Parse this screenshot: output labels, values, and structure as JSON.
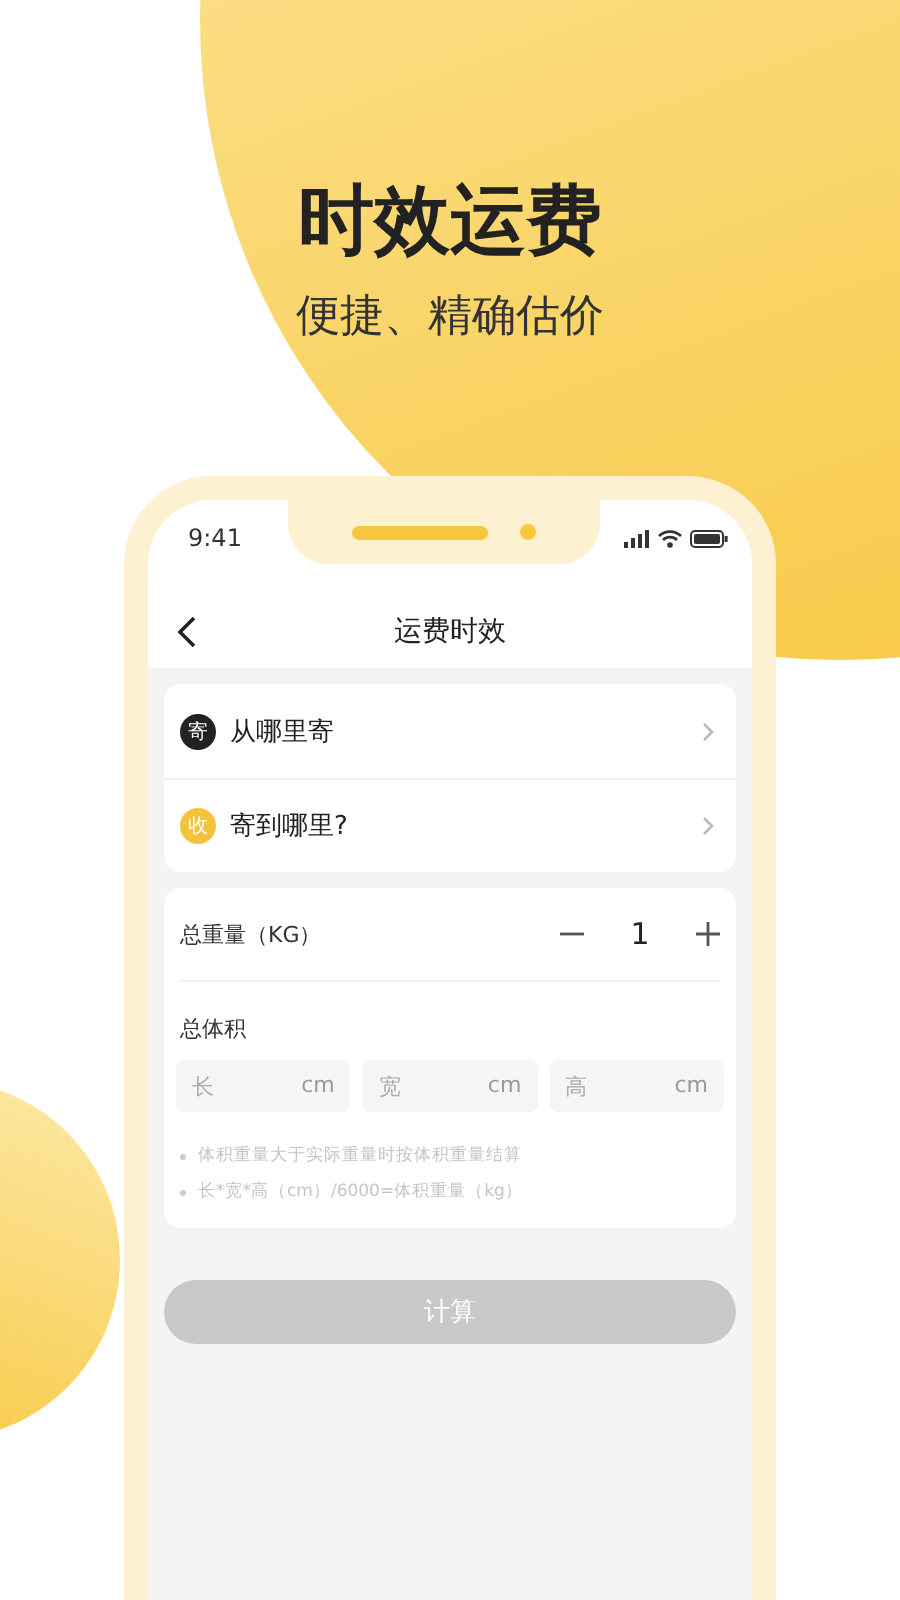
{
  "headline": "时效运费",
  "subtitle": "便捷、精确估价",
  "status_bar": {
    "time": "9:41"
  },
  "nav": {
    "title": "运费时效"
  },
  "addresses": [
    {
      "badge": "寄",
      "color": "#222222",
      "label": "从哪里寄"
    },
    {
      "badge": "收",
      "color": "#f5c33b",
      "label": "寄到哪里?"
    }
  ],
  "weight": {
    "label": "总重量（KG）",
    "value": "1"
  },
  "volume": {
    "label": "总体积",
    "fields": [
      {
        "placeholder": "长",
        "unit": "cm"
      },
      {
        "placeholder": "宽",
        "unit": "cm"
      },
      {
        "placeholder": "高",
        "unit": "cm"
      }
    ]
  },
  "notes": [
    "体积重量大于实际重量时按体积重量结算",
    "长*宽*高（cm）/6000=体积重量（kg）"
  ],
  "calculate_button": {
    "label": "计算",
    "disabled": true
  }
}
